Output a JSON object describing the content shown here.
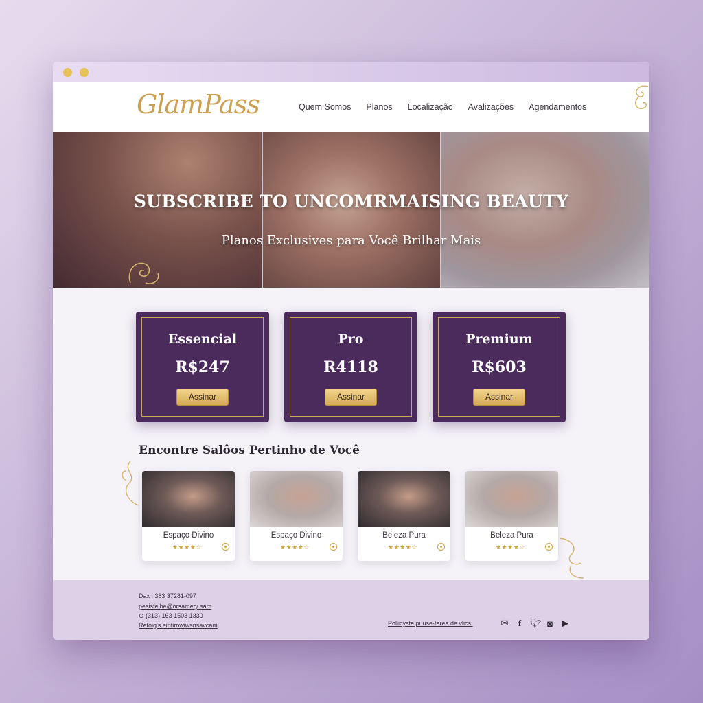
{
  "brand": {
    "logo": "GlamPass",
    "gold": "#cba052",
    "purple": "#4b2a5c"
  },
  "nav": {
    "items": [
      "Quem Somos",
      "Planos",
      "Localização",
      "Avalizações",
      "Agendamentos"
    ]
  },
  "hero": {
    "title": "SUBSCRIBE TO UNCOMRMAISING BEAUTY",
    "subtitle": "Planos Exclusives para Você Brilhar Mais"
  },
  "plans": [
    {
      "name": "Essencial",
      "price": "R$247",
      "button": "Assinar"
    },
    {
      "name": "Pro",
      "price": "R4118",
      "button": "Assinar"
    },
    {
      "name": "Premium",
      "price": "R$603",
      "button": "Assinar"
    }
  ],
  "salons_section": {
    "title": "Encontre Salôos Pertinho de Você",
    "items": [
      {
        "name": "Espaço Divino",
        "stars": "★★★★☆"
      },
      {
        "name": "Espaço Divino",
        "stars": "★★★★☆"
      },
      {
        "name": "Beleza Pura",
        "stars": "★★★★☆"
      },
      {
        "name": "Beleza Pura",
        "stars": "★★★★☆"
      }
    ]
  },
  "footer": {
    "line1": "Dax | 383 37281-097",
    "line2": "pesisfelbe@orsamety sam",
    "line3": "⊙ (313) 163 1503 1330",
    "line4": "Retoig's eintirowiwsnsavcam",
    "policy": "Poliicyste puuse-terea de vlics:",
    "social_icons": [
      "mail-icon",
      "facebook-icon",
      "twitter-icon",
      "instagram-icon",
      "youtube-icon"
    ]
  }
}
